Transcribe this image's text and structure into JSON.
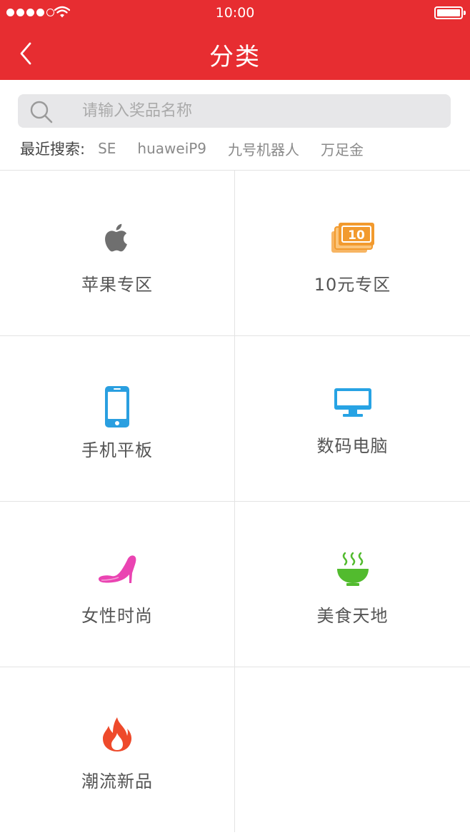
{
  "status_bar": {
    "time": "10:00"
  },
  "header": {
    "title": "分类"
  },
  "search": {
    "placeholder": "请输入奖品名称"
  },
  "recent": {
    "label": "最近搜索:",
    "tags": [
      "SE",
      "huaweiP9",
      "九号机器人",
      "万足金"
    ]
  },
  "categories": [
    {
      "label": "苹果专区",
      "icon": "apple-icon",
      "color": "#6f6f6f"
    },
    {
      "label": "10元专区",
      "icon": "cash-icon",
      "color": "#f29a2e",
      "icon_text": "10"
    },
    {
      "label": "手机平板",
      "icon": "phone-icon",
      "color": "#2a9fe0"
    },
    {
      "label": "数码电脑",
      "icon": "monitor-icon",
      "color": "#27a3e4"
    },
    {
      "label": "女性时尚",
      "icon": "high-heel-icon",
      "color": "#ea44b2"
    },
    {
      "label": "美食天地",
      "icon": "soup-bowl-icon",
      "color": "#52bb2e"
    },
    {
      "label": "潮流新品",
      "icon": "flame-icon",
      "color": "#ee4a2b"
    }
  ],
  "colors": {
    "brand_red": "#e72d31",
    "search_bg": "#e7e7e9",
    "divider": "#e3e3e3"
  }
}
